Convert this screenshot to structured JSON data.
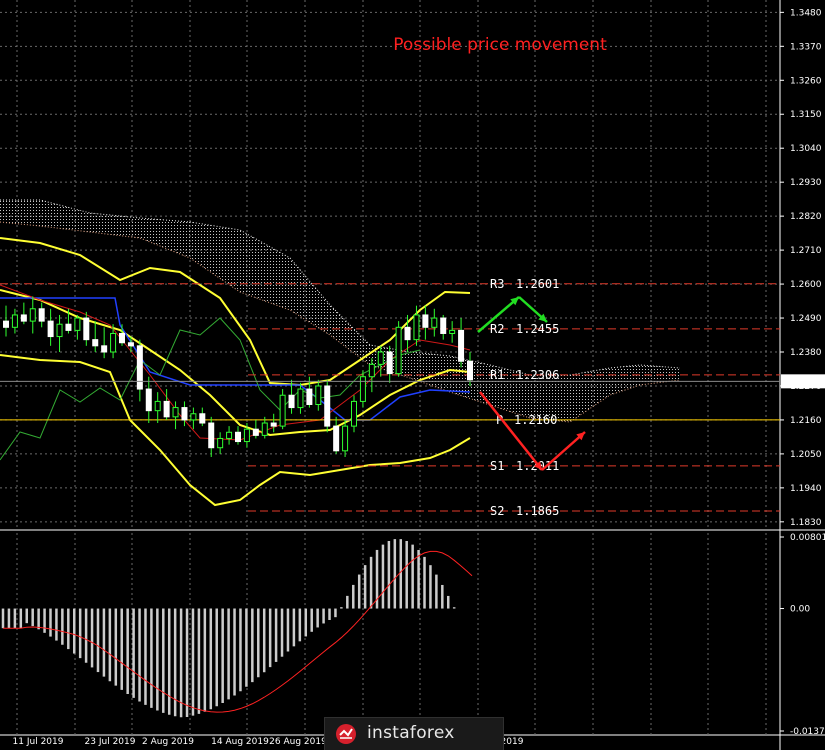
{
  "chart_data": [
    {
      "type": "candlestick",
      "title": "Possible price movement",
      "current_price": "1.2285",
      "y_ticks": [
        "1.3480",
        "1.3370",
        "1.3260",
        "1.3150",
        "1.3040",
        "1.2930",
        "1.2820",
        "1.2710",
        "1.2600",
        "1.2490",
        "1.2380",
        "1.2270",
        "1.2160",
        "1.2050",
        "1.1940",
        "1.1830"
      ],
      "x_ticks": [
        "11 Jul 2019",
        "23 Jul 2019",
        "2 Aug 2019",
        "14 Aug 2019",
        "26 Aug 2019",
        "2019"
      ],
      "ylim": [
        1.181,
        1.352
      ],
      "pivot_levels": [
        {
          "label": "R3",
          "value": "1.2601"
        },
        {
          "label": "R2",
          "value": "1.2455"
        },
        {
          "label": "R1",
          "value": "1.2306"
        },
        {
          "label": "P",
          "value": "1.2160"
        },
        {
          "label": "S1",
          "value": "1.2011"
        },
        {
          "label": "S2",
          "value": "1.1865"
        }
      ],
      "candles": [
        [
          1.248,
          1.253,
          1.243,
          1.246
        ],
        [
          1.246,
          1.252,
          1.244,
          1.25
        ],
        [
          1.25,
          1.254,
          1.247,
          1.248
        ],
        [
          1.248,
          1.256,
          1.244,
          1.252
        ],
        [
          1.252,
          1.254,
          1.246,
          1.248
        ],
        [
          1.248,
          1.252,
          1.24,
          1.243
        ],
        [
          1.243,
          1.25,
          1.238,
          1.247
        ],
        [
          1.247,
          1.252,
          1.244,
          1.245
        ],
        [
          1.245,
          1.25,
          1.242,
          1.249
        ],
        [
          1.249,
          1.251,
          1.24,
          1.242
        ],
        [
          1.242,
          1.248,
          1.238,
          1.24
        ],
        [
          1.24,
          1.246,
          1.236,
          1.238
        ],
        [
          1.238,
          1.247,
          1.236,
          1.244
        ],
        [
          1.244,
          1.247,
          1.24,
          1.241
        ],
        [
          1.241,
          1.243,
          1.238,
          1.24
        ],
        [
          1.24,
          1.242,
          1.222,
          1.226
        ],
        [
          1.226,
          1.23,
          1.215,
          1.219
        ],
        [
          1.219,
          1.225,
          1.215,
          1.222
        ],
        [
          1.222,
          1.226,
          1.216,
          1.217
        ],
        [
          1.217,
          1.222,
          1.213,
          1.22
        ],
        [
          1.22,
          1.222,
          1.214,
          1.216
        ],
        [
          1.216,
          1.22,
          1.213,
          1.218
        ],
        [
          1.218,
          1.22,
          1.214,
          1.215
        ],
        [
          1.215,
          1.217,
          1.204,
          1.207
        ],
        [
          1.207,
          1.212,
          1.205,
          1.21
        ],
        [
          1.21,
          1.214,
          1.208,
          1.212
        ],
        [
          1.212,
          1.214,
          1.208,
          1.209
        ],
        [
          1.209,
          1.215,
          1.207,
          1.213
        ],
        [
          1.213,
          1.216,
          1.21,
          1.211
        ],
        [
          1.211,
          1.217,
          1.21,
          1.215
        ],
        [
          1.215,
          1.218,
          1.212,
          1.214
        ],
        [
          1.214,
          1.226,
          1.213,
          1.224
        ],
        [
          1.224,
          1.229,
          1.218,
          1.22
        ],
        [
          1.22,
          1.228,
          1.218,
          1.226
        ],
        [
          1.226,
          1.23,
          1.22,
          1.221
        ],
        [
          1.221,
          1.229,
          1.219,
          1.227
        ],
        [
          1.227,
          1.229,
          1.212,
          1.214
        ],
        [
          1.214,
          1.217,
          1.205,
          1.206
        ],
        [
          1.206,
          1.216,
          1.204,
          1.214
        ],
        [
          1.214,
          1.224,
          1.212,
          1.222
        ],
        [
          1.222,
          1.232,
          1.22,
          1.23
        ],
        [
          1.23,
          1.236,
          1.225,
          1.234
        ],
        [
          1.234,
          1.24,
          1.23,
          1.238
        ],
        [
          1.238,
          1.24,
          1.228,
          1.231
        ],
        [
          1.231,
          1.248,
          1.23,
          1.246
        ],
        [
          1.246,
          1.25,
          1.238,
          1.242
        ],
        [
          1.242,
          1.253,
          1.24,
          1.25
        ],
        [
          1.25,
          1.253,
          1.242,
          1.246
        ],
        [
          1.246,
          1.252,
          1.243,
          1.249
        ],
        [
          1.249,
          1.25,
          1.242,
          1.244
        ],
        [
          1.244,
          1.248,
          1.241,
          1.245
        ],
        [
          1.245,
          1.249,
          1.233,
          1.235
        ],
        [
          1.235,
          1.238,
          1.227,
          1.229
        ]
      ],
      "annotation_arrows": [
        {
          "color": "#22dd22",
          "description": "up then down near R3"
        },
        {
          "color": "#ff2222",
          "description": "down from R1 to S1 then up toward P"
        }
      ]
    },
    {
      "type": "histogram",
      "indicator": "oscillator",
      "y_ticks": [
        "0.00801",
        "0.00",
        "-0.01371"
      ],
      "ylim": [
        -0.01371,
        0.00801
      ]
    }
  ],
  "watermark": {
    "brand": "instaforex"
  },
  "colors": {
    "pivot": "#e03a2a",
    "pivot_p": "#ffd000",
    "bollinger": "#ffff33",
    "signal": "#ff2222",
    "histogram": "#cccccc",
    "title": "#ff2020",
    "green_arrow": "#22dd22",
    "red_arrow": "#ff2222"
  }
}
